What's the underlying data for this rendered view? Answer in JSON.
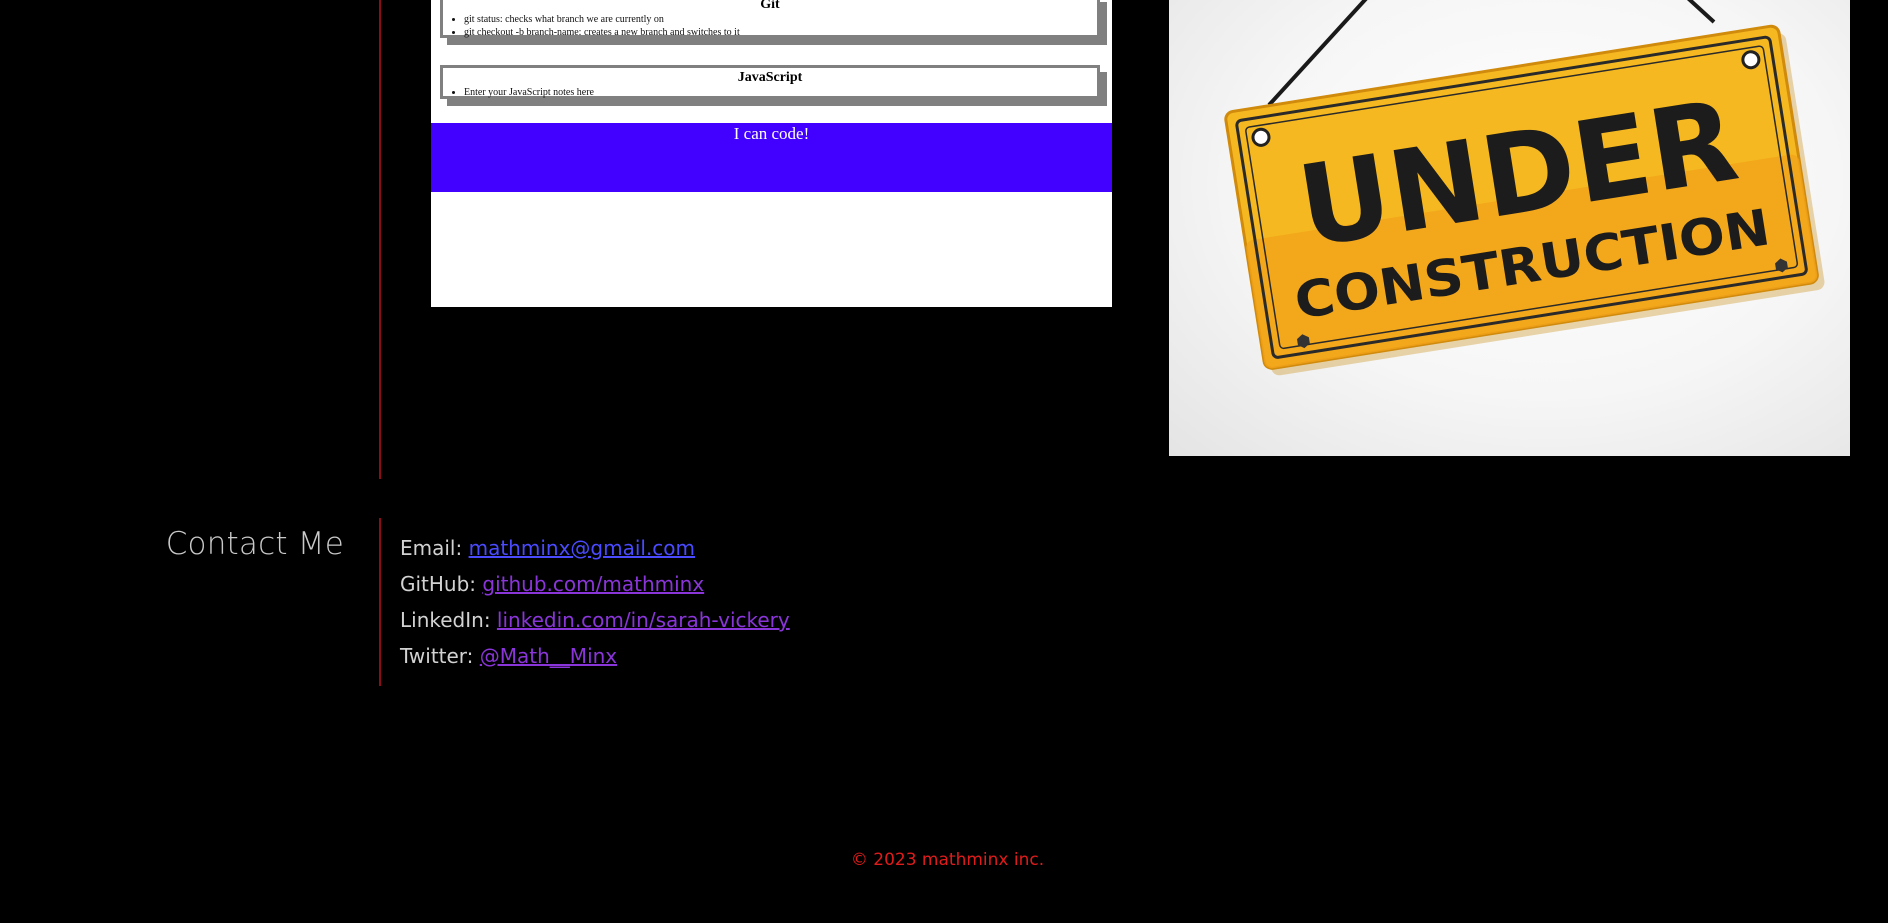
{
  "project_preview": {
    "git_title": "Git",
    "git_notes": [
      "git status: checks what branch we are currently on",
      "git checkout -b branch-name: creates a new branch and switches to it"
    ],
    "js_title": "JavaScript",
    "js_notes": [
      "Enter your JavaScript notes here"
    ],
    "banner_text": "I can code!",
    "banner_color": "#4200ff"
  },
  "under_construction": {
    "line1": "UNDER",
    "line2": "CONSTRUCTION",
    "sign_color": "#f5b820"
  },
  "contact": {
    "heading": "Contact Me",
    "items": [
      {
        "label": "Email: ",
        "value": "mathminx@gmail.com"
      },
      {
        "label": "GitHub: ",
        "value": "github.com/mathminx"
      },
      {
        "label": "LinkedIn: ",
        "value": "linkedin.com/in/sarah-vickery"
      },
      {
        "label": "Twitter: ",
        "value": "@Math__Minx"
      }
    ]
  },
  "footer": {
    "copyright": "© 2023 mathminx inc."
  },
  "colors": {
    "background": "#000000",
    "divider": "#8b0d15",
    "link_blue": "#4a4aff",
    "link_purple": "#8a35d9",
    "footer_red": "#e01b1b"
  }
}
